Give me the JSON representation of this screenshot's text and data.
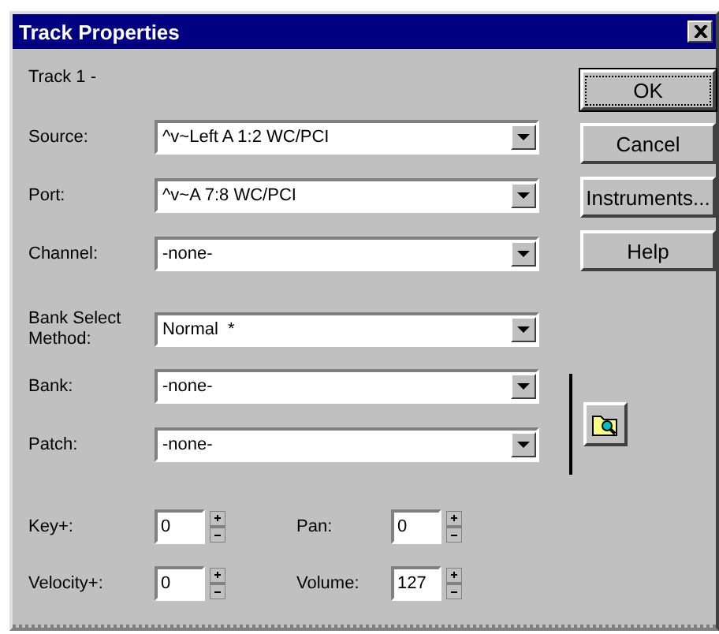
{
  "window": {
    "title": "Track Properties"
  },
  "track_label": "Track 1 -",
  "combos": [
    {
      "label": "Source:",
      "value": "^v~Left A 1:2 WC/PCI"
    },
    {
      "label": "Port:",
      "value": "^v~A 7:8 WC/PCI"
    },
    {
      "label": "Channel:",
      "value": "-none-"
    }
  ],
  "bank_select": {
    "label_line1": "Bank Select",
    "label_line2": "Method:",
    "value": "Normal  *"
  },
  "bank_combos": [
    {
      "label": "Bank:",
      "value": "-none-"
    },
    {
      "label": "Patch:",
      "value": "-none-"
    }
  ],
  "spinners": [
    {
      "label": "Key+:",
      "value": "0"
    },
    {
      "label": "Pan:",
      "value": "0"
    },
    {
      "label": "Velocity+:",
      "value": "0"
    },
    {
      "label": "Volume:",
      "value": "127"
    }
  ],
  "buttons": [
    {
      "label": "OK",
      "default": true
    },
    {
      "label": "Cancel",
      "default": false
    },
    {
      "label": "Instruments...",
      "default": false
    },
    {
      "label": "Help",
      "default": false
    }
  ]
}
